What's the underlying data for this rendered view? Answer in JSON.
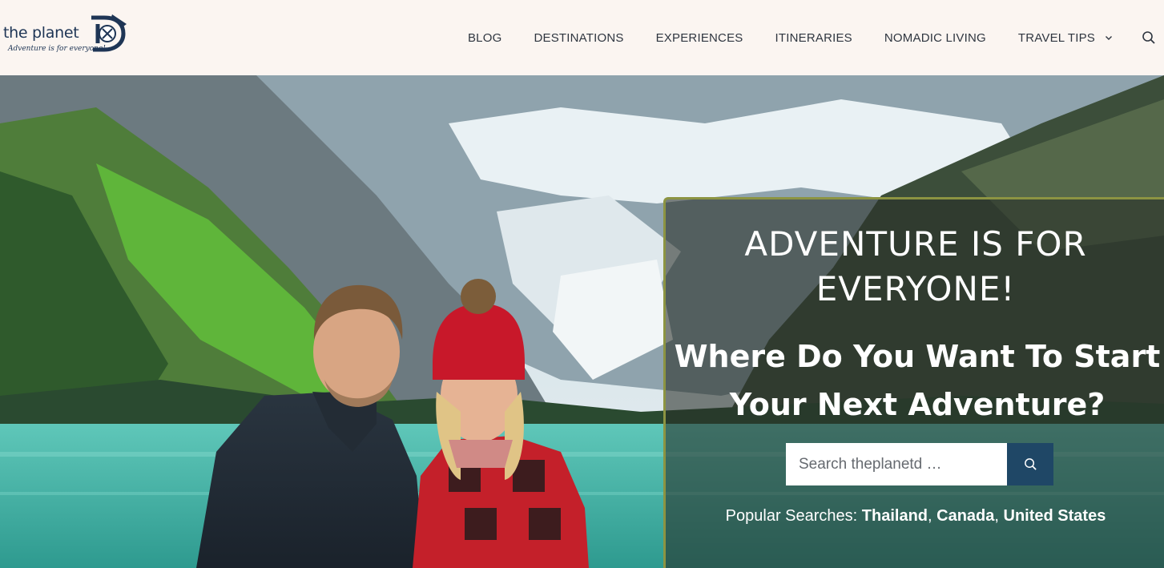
{
  "logo": {
    "word": "the planet",
    "mark": "D",
    "tagline": "Adventure is for everyone!"
  },
  "nav": {
    "items": [
      {
        "label": "BLOG"
      },
      {
        "label": "DESTINATIONS"
      },
      {
        "label": "EXPERIENCES"
      },
      {
        "label": "ITINERARIES"
      },
      {
        "label": "NOMADIC LIVING"
      },
      {
        "label": "TRAVEL TIPS",
        "icon": "chevron-down-icon"
      }
    ],
    "search_icon": "search-icon"
  },
  "hero": {
    "title": "ADVENTURE IS FOR EVERYONE!",
    "subtitle": "Where Do You Want To Start Your Next Adventure?",
    "search": {
      "placeholder": "Search theplanetd …",
      "button_icon": "search-icon"
    },
    "popular": {
      "label": "Popular Searches:",
      "links": [
        "Thailand",
        "Canada",
        "United States"
      ]
    }
  },
  "colors": {
    "header_bg": "#fbf5f1",
    "panel_border": "#8c9442",
    "search_button": "#1f4766",
    "brand_navy": "#1e3555"
  }
}
